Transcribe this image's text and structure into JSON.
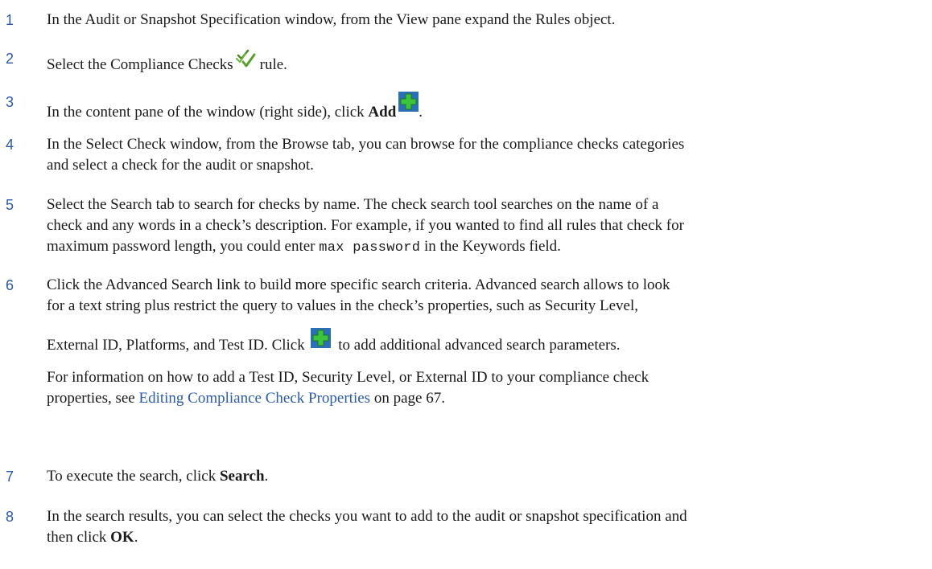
{
  "steps": [
    {
      "num": "1",
      "text": "In the Audit or Snapshot Specification window, from the View pane expand the Rules object."
    },
    {
      "num": "2",
      "before": "Select the Compliance Checks",
      "after": "rule.",
      "icon": "compliance-checks-icon"
    },
    {
      "num": "3",
      "before": "In the content pane of the window (right side), click ",
      "bold": "Add",
      "after": ".",
      "icon": "green-plus-icon"
    },
    {
      "num": "4",
      "line1": "In the Select Check window, from the Browse tab, you can browse for the compliance checks categories",
      "line2": "and select a check for the audit or snapshot."
    },
    {
      "num": "5",
      "line1": "Select the Search tab to search for checks by name. The check search tool searches on the name of a",
      "line2": "check and any words in a check’s description. For example, if you wanted to find all rules that check for",
      "line3_before": "maximum password length, you could enter ",
      "line3_code": "max password",
      "line3_after": " in the Keywords field."
    },
    {
      "num": "6",
      "line1": "Click the Advanced Search link to build more specific search criteria. Advanced search allows to look",
      "line2": "for a text string plus restrict the query to values in the check’s properties, such as Security Level,",
      "line3_before": "External ID, Platforms, and Test ID. Click ",
      "line3_after": " to add additional advanced search parameters.",
      "note_line1": "For information on how to add a Test ID, Security Level, or External ID to your compliance check",
      "note_before": "properties, see ",
      "note_link": "Editing Compliance Check Properties",
      "note_after": " on page 67.",
      "icon": "green-plus-icon"
    },
    {
      "num": "7",
      "before": "To execute the search, click ",
      "bold": "Search",
      "after": "."
    },
    {
      "num": "8",
      "line1": "In the search results, you can select the checks you want to add to the audit or snapshot specification and",
      "line2_before": "then click ",
      "line2_bold": "OK",
      "line2_after": "."
    }
  ],
  "colors": {
    "step_number": "#2a5aa8",
    "link": "#2a5aa8",
    "text": "#1a1a1a",
    "plus_icon": "#3cc43c"
  }
}
